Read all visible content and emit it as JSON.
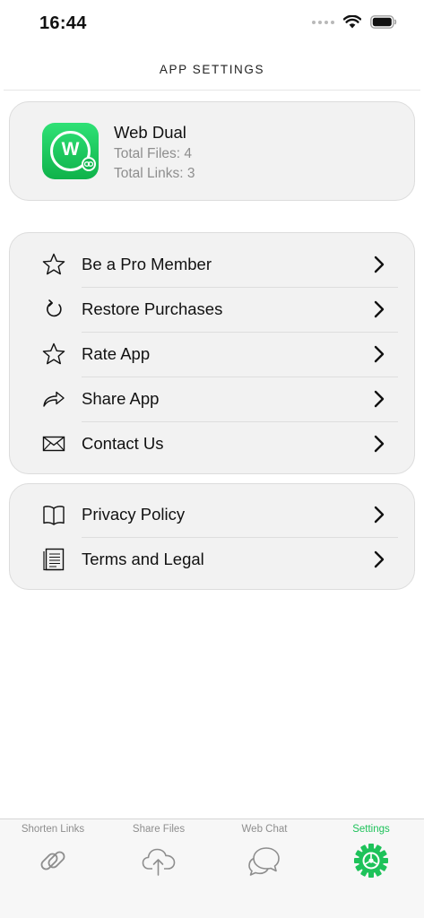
{
  "status_bar": {
    "time": "16:44"
  },
  "header": {
    "title": "APP SETTINGS"
  },
  "app_info": {
    "name": "Web Dual",
    "icon_letter": "W",
    "total_files": "Total Files: 4",
    "total_links": "Total Links: 3"
  },
  "menu_group_1": [
    {
      "label": "Be a Pro Member",
      "icon": "star-icon"
    },
    {
      "label": "Restore Purchases",
      "icon": "restore-icon"
    },
    {
      "label": "Rate App",
      "icon": "star-icon"
    },
    {
      "label": "Share App",
      "icon": "share-arrow-icon"
    },
    {
      "label": "Contact Us",
      "icon": "envelope-icon"
    }
  ],
  "menu_group_2": [
    {
      "label": "Privacy Policy",
      "icon": "book-icon"
    },
    {
      "label": "Terms and Legal",
      "icon": "document-icon"
    }
  ],
  "tabs": [
    {
      "label": "Shorten Links",
      "icon": "link-icon",
      "active": false
    },
    {
      "label": "Share Files",
      "icon": "cloud-upload-icon",
      "active": false
    },
    {
      "label": "Web Chat",
      "icon": "chat-bubbles-icon",
      "active": false
    },
    {
      "label": "Settings",
      "icon": "gear-icon",
      "active": true
    }
  ],
  "colors": {
    "accent": "#1ec25a",
    "card_bg": "#f2f2f2",
    "muted_text": "#8e8e8e"
  }
}
